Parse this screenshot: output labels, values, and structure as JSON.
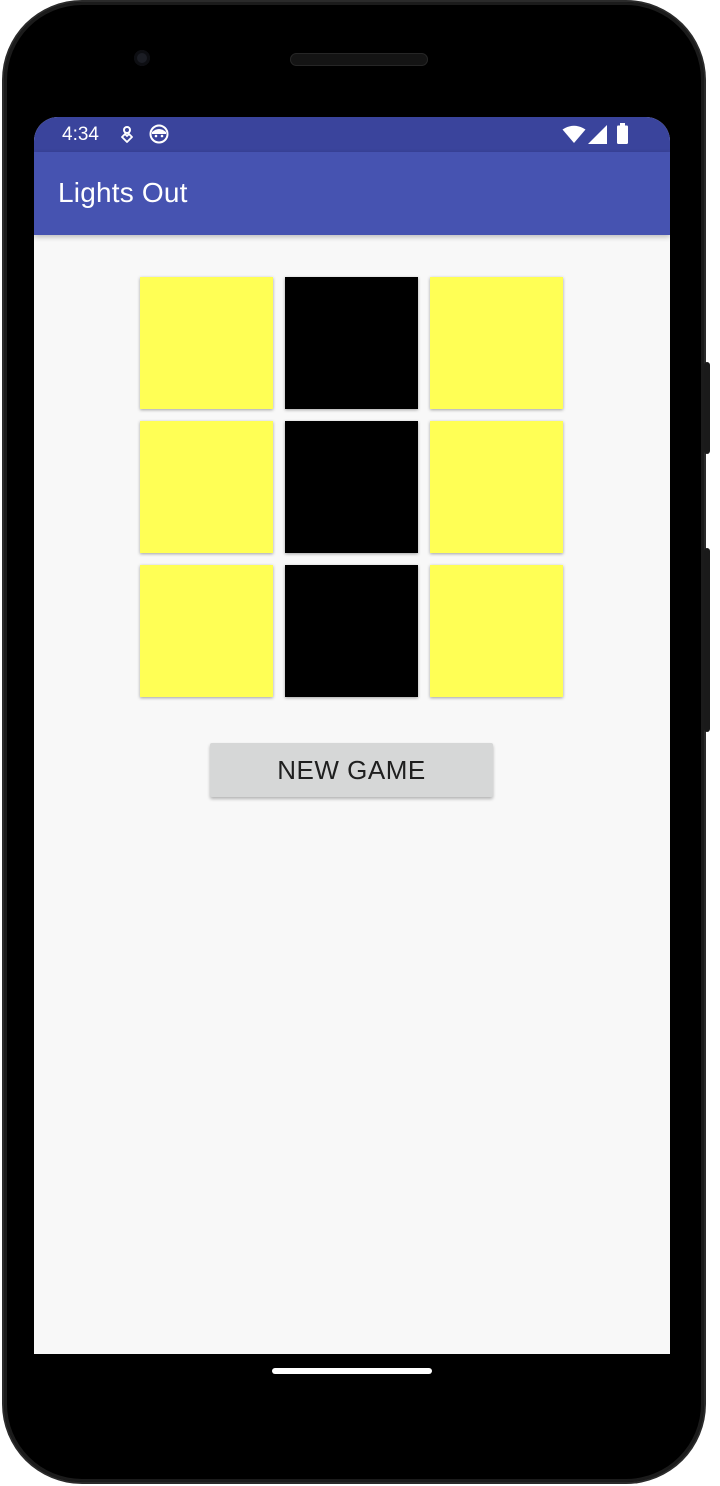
{
  "status_bar": {
    "time": "4:34",
    "left_icons": [
      "location-icon",
      "face-icon"
    ],
    "right_icons": [
      "wifi-icon",
      "signal-icon",
      "battery-icon"
    ],
    "color": "#3a449c"
  },
  "app_bar": {
    "title": "Lights Out",
    "color": "#4653b1"
  },
  "board": {
    "rows": 3,
    "cols": 3,
    "cells": [
      [
        true,
        false,
        true
      ],
      [
        true,
        false,
        true
      ],
      [
        true,
        false,
        true
      ]
    ],
    "on_color": "#ffff55",
    "off_color": "#000000"
  },
  "actions": {
    "new_game_label": "NEW GAME"
  }
}
